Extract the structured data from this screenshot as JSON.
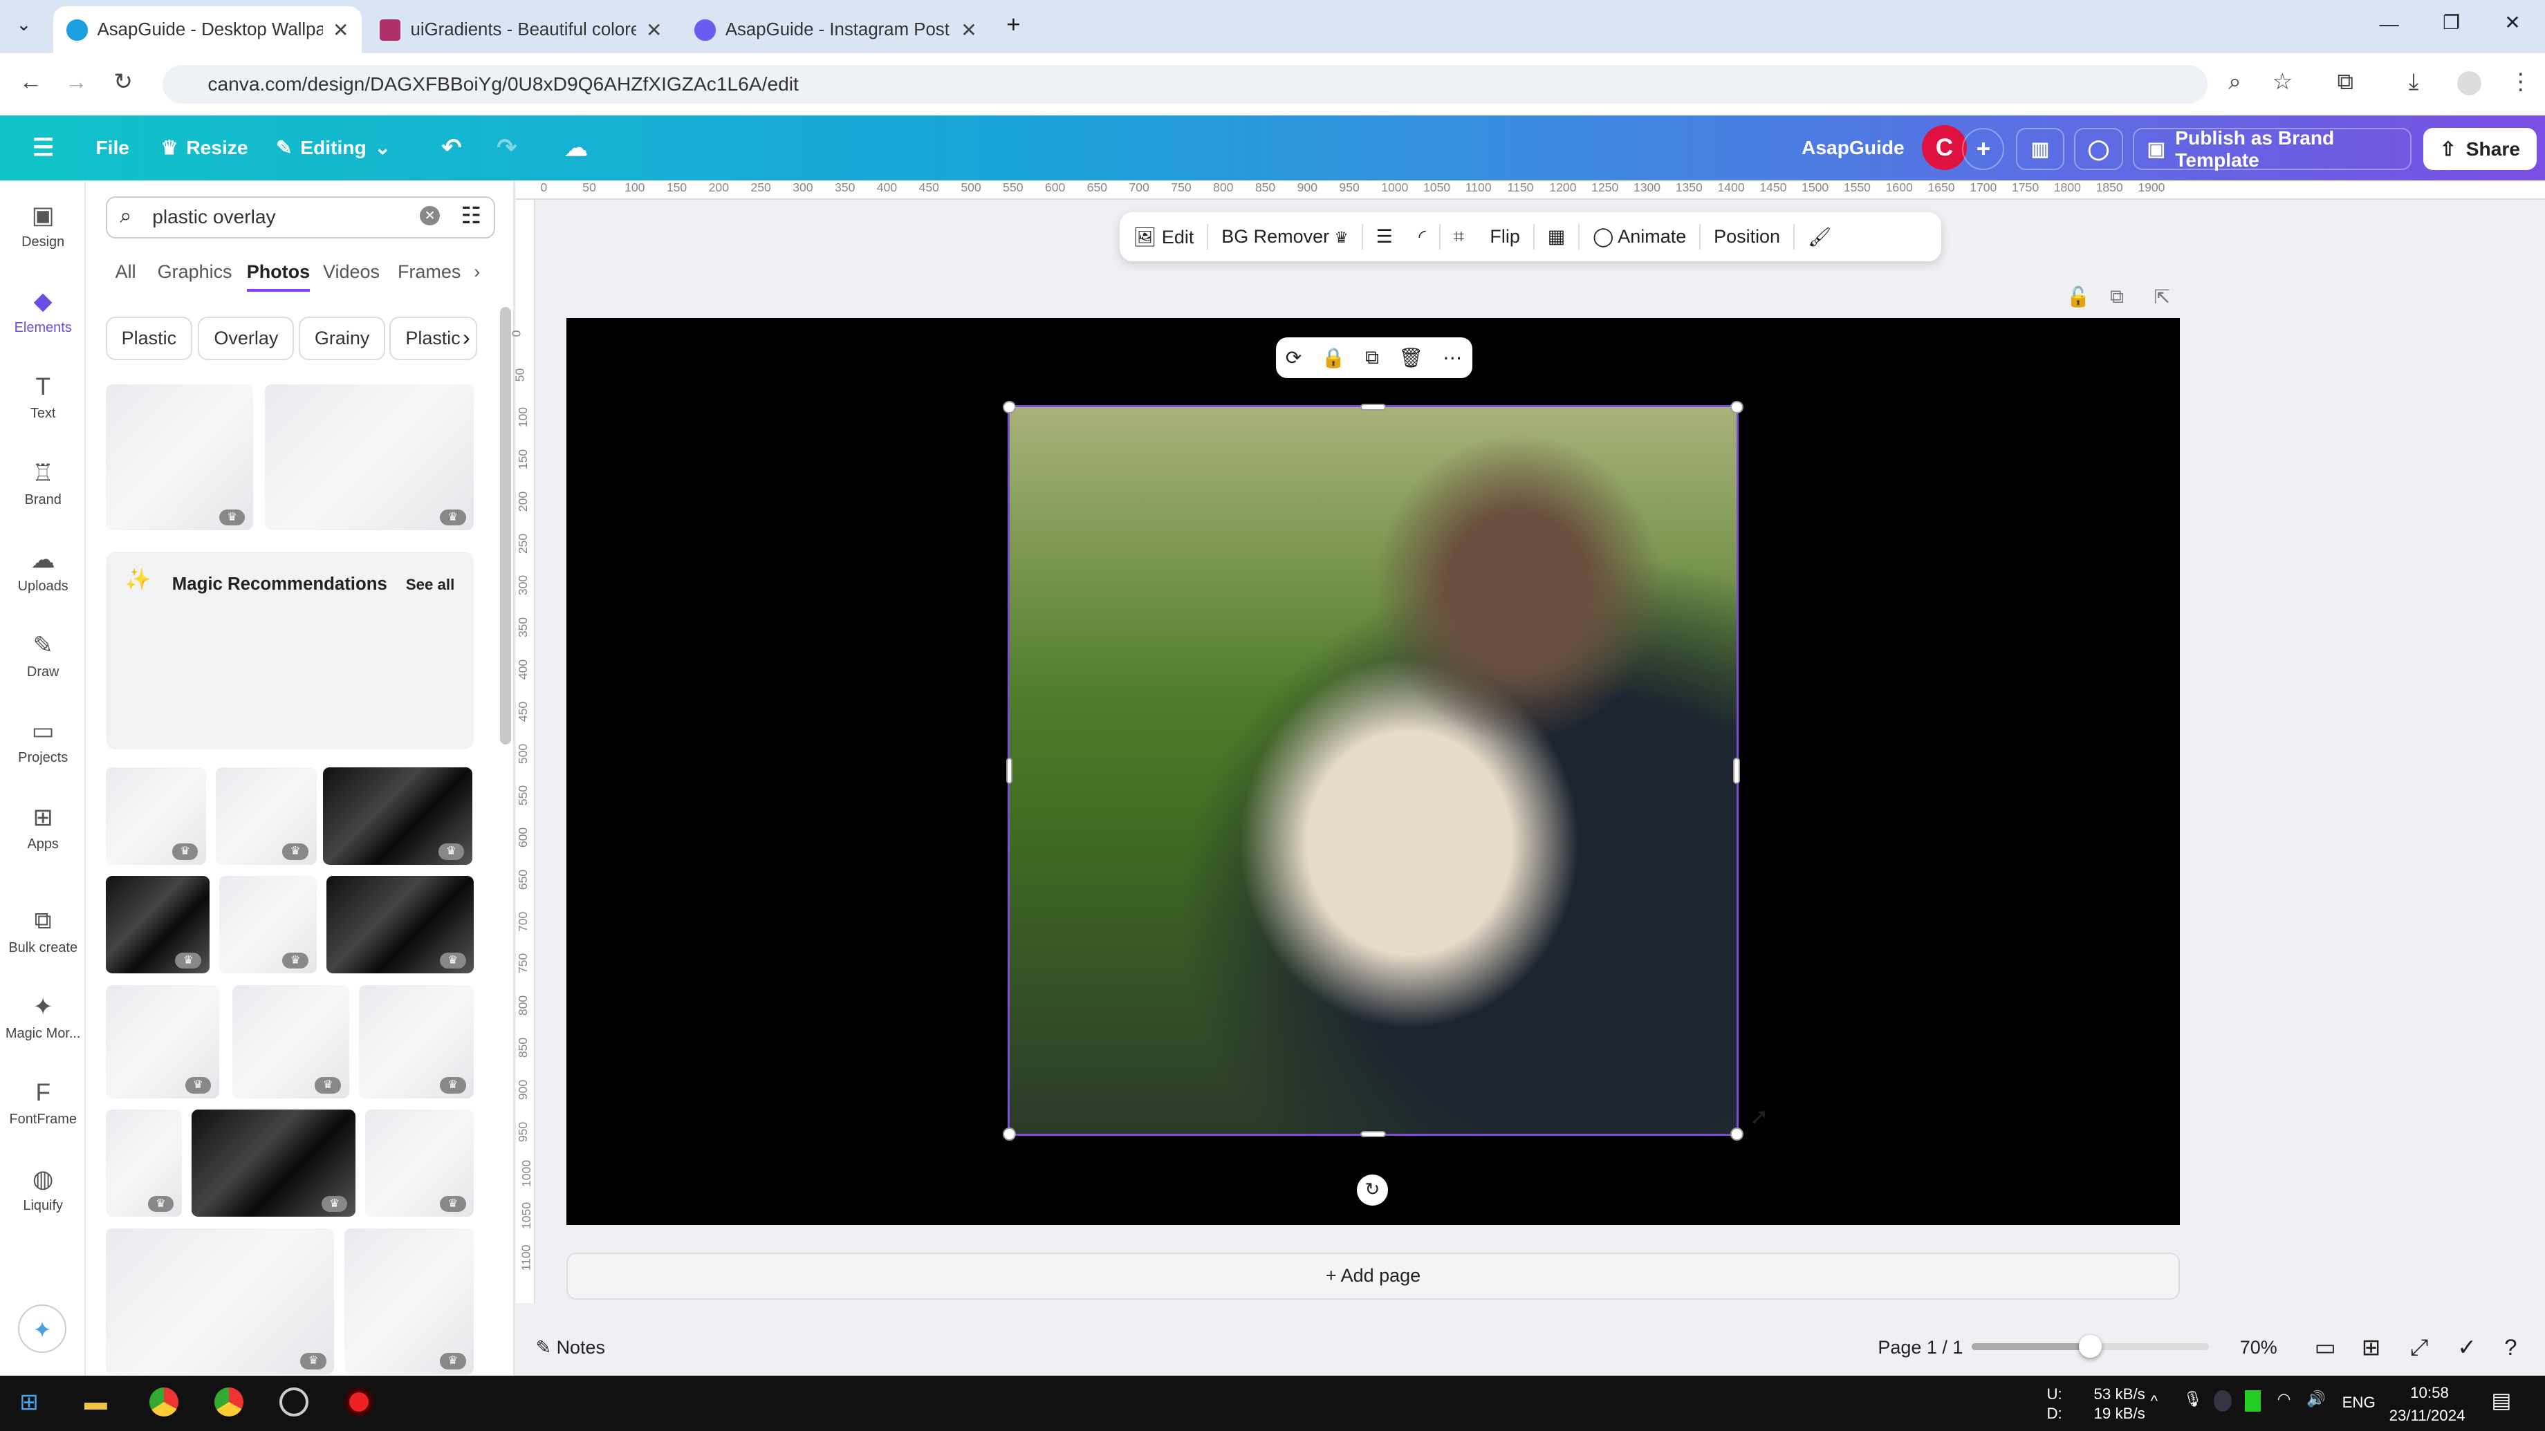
{
  "browser": {
    "tabs": [
      {
        "title": "AsapGuide - Desktop Wallpaper",
        "active": true
      },
      {
        "title": "uiGradients - Beautiful colored",
        "active": false
      },
      {
        "title": "AsapGuide - Instagram Post",
        "active": false
      }
    ],
    "url": "canva.com/design/DAGXFBBoiYg/0U8xD9Q6AHZfXIGZAc1L6A/edit"
  },
  "header": {
    "menu_icon": "hamburger-icon",
    "file": "File",
    "resize": "Resize",
    "editing": "Editing",
    "team": "AsapGuide",
    "avatar": "C",
    "publish": "Publish as Brand Template",
    "share": "Share"
  },
  "rail": [
    {
      "label": "Design",
      "icon": "▣"
    },
    {
      "label": "Elements",
      "icon": "◆"
    },
    {
      "label": "Text",
      "icon": "T"
    },
    {
      "label": "Brand",
      "icon": "♖"
    },
    {
      "label": "Uploads",
      "icon": "☁"
    },
    {
      "label": "Draw",
      "icon": "✎"
    },
    {
      "label": "Projects",
      "icon": "▭"
    },
    {
      "label": "Apps",
      "icon": "⊞"
    },
    {
      "label": "Bulk create",
      "icon": "⧉"
    },
    {
      "label": "Magic Mor...",
      "icon": "✦"
    },
    {
      "label": "FontFrame",
      "icon": "F"
    },
    {
      "label": "Liquify",
      "icon": "◍"
    }
  ],
  "panel": {
    "search_value": "plastic overlay",
    "tabs": [
      "All",
      "Graphics",
      "Photos",
      "Videos",
      "Frames"
    ],
    "active_tab": "Photos",
    "chips": [
      "Plastic",
      "Overlay",
      "Grainy",
      "Plastic"
    ],
    "magic_title": "Magic Recommendations",
    "see_all": "See all"
  },
  "ruler": {
    "h": [
      "0",
      "50",
      "100",
      "150",
      "200",
      "250",
      "300",
      "350",
      "400",
      "450",
      "500",
      "550",
      "600",
      "650",
      "700",
      "750",
      "800",
      "850",
      "900",
      "950",
      "1000",
      "1050",
      "1100",
      "1150",
      "1200",
      "1250",
      "1300",
      "1350",
      "1400",
      "1450",
      "1500",
      "1550",
      "1600",
      "1650",
      "1700",
      "1750",
      "1800",
      "1850",
      "1900"
    ],
    "v": [
      "0",
      "50",
      "100",
      "150",
      "200",
      "250",
      "300",
      "350",
      "400",
      "450",
      "500",
      "550",
      "600",
      "650",
      "700",
      "750",
      "800",
      "850",
      "900",
      "950",
      "1000",
      "1050",
      "1100"
    ]
  },
  "context_toolbar": {
    "edit": "Edit",
    "bg_remover": "BG Remover",
    "flip": "Flip",
    "animate": "Animate",
    "position": "Position"
  },
  "add_page": "+ Add page",
  "footer": {
    "notes": "Notes",
    "page": "Page 1 / 1",
    "zoom": "70%",
    "zoom_fraction": 0.5
  },
  "taskbar": {
    "up": "U:",
    "down": "D:",
    "up_rate": "53 kB/s",
    "down_rate": "19 kB/s",
    "lang": "ENG",
    "time": "10:58",
    "date": "23/11/2024"
  }
}
